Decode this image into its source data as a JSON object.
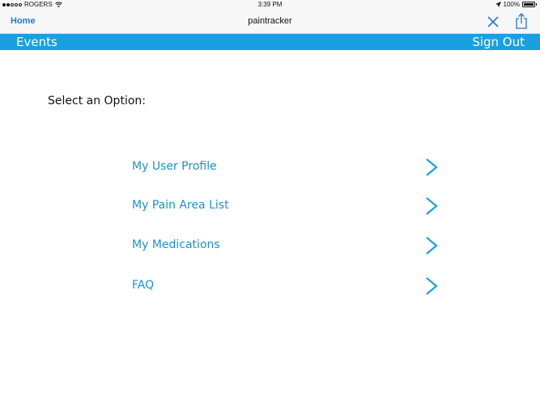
{
  "status": {
    "carrier": "ROGERS",
    "time": "3:39 PM",
    "battery": "100%"
  },
  "nav": {
    "home_label": "Home",
    "title": "paintracker"
  },
  "header": {
    "events_label": "Events",
    "signout_label": "Sign Out"
  },
  "main": {
    "prompt": "Select an Option:",
    "items": [
      {
        "label": "My User Profile"
      },
      {
        "label": "My Pain Area List"
      },
      {
        "label": "My Medications"
      },
      {
        "label": "FAQ"
      }
    ]
  },
  "colors": {
    "accent": "#1aa0e0",
    "link": "#1f8fc9",
    "ios_blue": "#1f7ad6"
  },
  "icons": [
    "wifi-icon",
    "location-icon",
    "battery-icon",
    "close-icon",
    "share-icon",
    "chevron-right-icon"
  ]
}
